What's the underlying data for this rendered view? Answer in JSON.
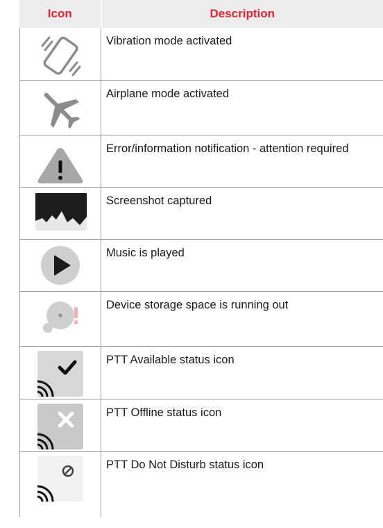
{
  "table": {
    "header": {
      "icon": "Icon",
      "description": "Description"
    },
    "rows": [
      {
        "icon": "vibration-icon",
        "text": "Vibration mode activated"
      },
      {
        "icon": "airplane-icon",
        "text": "Airplane mode activated"
      },
      {
        "icon": "warning-icon",
        "text": "Error/information notification - attention required"
      },
      {
        "icon": "screenshot-icon",
        "text": "Screenshot captured"
      },
      {
        "icon": "play-icon",
        "text": "Music is played"
      },
      {
        "icon": "storage-warning-icon",
        "text": "Device storage space is running out"
      },
      {
        "icon": "ptt-available-icon",
        "text": "PTT Available status icon"
      },
      {
        "icon": "ptt-offline-icon",
        "text": "PTT Offline status icon"
      },
      {
        "icon": "ptt-dnd-icon",
        "text": "PTT Do Not Disturb status icon"
      }
    ]
  },
  "colors": {
    "header_text": "#e8202f",
    "header_bg": "#ececec",
    "icon_gray": "#8c8c8c"
  }
}
